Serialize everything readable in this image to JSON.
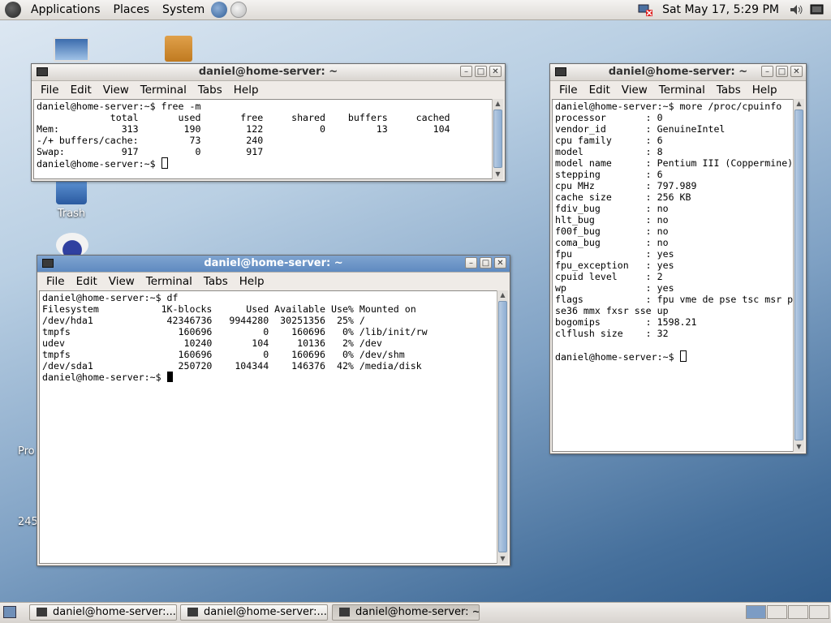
{
  "top_panel": {
    "menus": [
      "Applications",
      "Places",
      "System"
    ],
    "clock": "Sat May 17,  5:29 PM"
  },
  "desktop": {
    "icons": [
      {
        "label": "Trash"
      },
      {
        "label": "Pro"
      },
      {
        "label": "245"
      }
    ]
  },
  "windows": [
    {
      "title": "daniel@home-server: ~",
      "menus": [
        "File",
        "Edit",
        "View",
        "Terminal",
        "Tabs",
        "Help"
      ],
      "lines": [
        "daniel@home-server:~$ free -m",
        "             total       used       free     shared    buffers     cached",
        "Mem:           313        190        122          0         13        104",
        "-/+ buffers/cache:         73        240",
        "Swap:          917          0        917",
        "daniel@home-server:~$ "
      ]
    },
    {
      "title": "daniel@home-server: ~",
      "menus": [
        "File",
        "Edit",
        "View",
        "Terminal",
        "Tabs",
        "Help"
      ],
      "lines": [
        "daniel@home-server:~$ more /proc/cpuinfo",
        "processor       : 0",
        "vendor_id       : GenuineIntel",
        "cpu family      : 6",
        "model           : 8",
        "model name      : Pentium III (Coppermine)",
        "stepping        : 6",
        "cpu MHz         : 797.989",
        "cache size      : 256 KB",
        "fdiv_bug        : no",
        "hlt_bug         : no",
        "f00f_bug        : no",
        "coma_bug        : no",
        "fpu             : yes",
        "fpu_exception   : yes",
        "cpuid level     : 2",
        "wp              : yes",
        "flags           : fpu vme de pse tsc msr p",
        "se36 mmx fxsr sse up",
        "bogomips        : 1598.21",
        "clflush size    : 32",
        "",
        "daniel@home-server:~$ "
      ]
    },
    {
      "title": "daniel@home-server: ~",
      "menus": [
        "File",
        "Edit",
        "View",
        "Terminal",
        "Tabs",
        "Help"
      ],
      "lines": [
        "daniel@home-server:~$ df",
        "Filesystem           1K-blocks      Used Available Use% Mounted on",
        "/dev/hda1             42346736   9944280  30251356  25% /",
        "tmpfs                   160696         0    160696   0% /lib/init/rw",
        "udev                     10240       104     10136   2% /dev",
        "tmpfs                   160696         0    160696   0% /dev/shm",
        "/dev/sda1               250720    104344    146376  42% /media/disk",
        "daniel@home-server:~$ "
      ]
    }
  ],
  "taskbar": {
    "tasks": [
      "daniel@home-server:...",
      "daniel@home-server:...",
      "daniel@home-server: ~"
    ]
  },
  "colors": {
    "desktop_accent": "#46709c",
    "scroll_thumb": "#8eaed2",
    "active_workspace": "#7c9cc4"
  }
}
